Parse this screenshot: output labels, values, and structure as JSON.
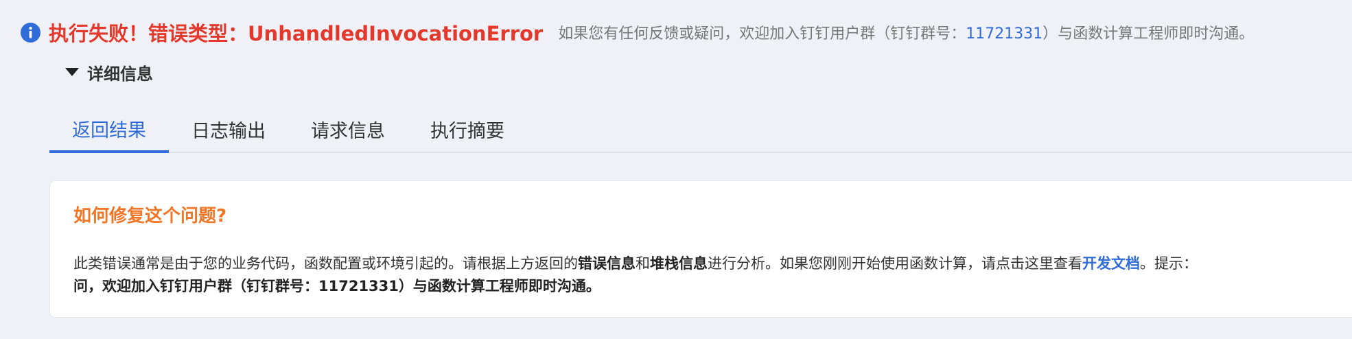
{
  "error": {
    "icon": "info-icon",
    "title": "执行失败！错误类型：UnhandledInvocationError",
    "hint_prefix": "如果您有任何反馈或疑问，欢迎加入钉钉用户群（钉钉群号：",
    "group_number": "11721331",
    "hint_suffix": "）与函数计算工程师即时沟通。"
  },
  "details": {
    "label": "详细信息",
    "icon": "caret-down-icon"
  },
  "tabs": [
    {
      "label": "返回结果",
      "active": true
    },
    {
      "label": "日志输出",
      "active": false
    },
    {
      "label": "请求信息",
      "active": false
    },
    {
      "label": "执行摘要",
      "active": false
    }
  ],
  "help": {
    "title": "如何修复这个问题?",
    "p1_text1": "此类错误通常是由于您的业务代码，函数配置或环境引起的。请根据上方返回的",
    "p1_bold1": "错误信息",
    "p1_text2": "和",
    "p1_bold2": "堆栈信息",
    "p1_text3": "进行分析。如果您刚刚开始使用函数计算，请点击这里查看",
    "p1_link": "开发文档",
    "p1_text4": "。提示：",
    "line2": "问，欢迎加入钉钉用户群（钉钉群号：11721331）与函数计算工程师即时沟通。"
  },
  "colors": {
    "accent": "#2f6cd9",
    "error": "#e3392c",
    "warning_title": "#f07626",
    "background": "#eff1f6"
  }
}
